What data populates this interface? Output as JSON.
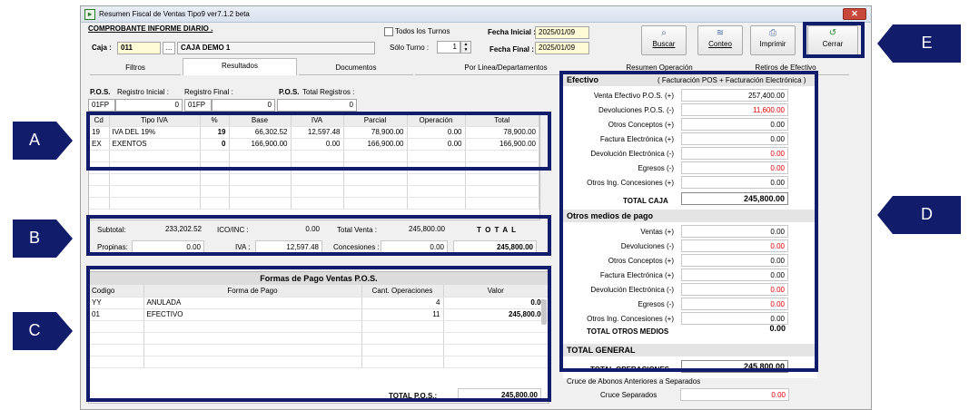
{
  "window": {
    "title": "Resumen Fiscal de Ventas Tipo9 ver7.1.2 beta",
    "close_glyph": "✕"
  },
  "header": {
    "report_title": "COMPROBANTE  INFORME DIARIO .",
    "caja_label": "Caja :",
    "caja_code": "011",
    "caja_browse": "...",
    "caja_name": "CAJA DEMO 1",
    "todos_turnos_label": "Todos los Turnos",
    "solo_turno_label": "Sólo Turno :",
    "solo_turno_value": "1",
    "fecha_inicial_label": "Fecha Inicial :",
    "fecha_inicial_value": "2025/01/09",
    "fecha_final_label": "Fecha Final :",
    "fecha_final_value": "2025/01/09"
  },
  "toolbar": {
    "buscar": "Buscar",
    "conteo": "Conteo",
    "imprimir": "Imprimir",
    "cerrar": "Cerrar"
  },
  "tabs": [
    "Filtros",
    "Resultados",
    "Documentos",
    "Por Linea/Departamentos",
    "Resumen Operación",
    "Retiros de Efectivo"
  ],
  "pos_info": {
    "pos_label": "P.O.S.",
    "registro_inicial_label": "Registro Inicial :",
    "registro_final_label": "Registro Final :",
    "pos2_label": "P.O.S.",
    "total_registros_label": "Total Registros :",
    "pos_ini": "01FP",
    "reg_ini": "0",
    "pos_fin": "01FP",
    "reg_fin": "0",
    "total_registros": "0"
  },
  "tax_table": {
    "columns": [
      "Cd",
      "Tipo IVA",
      "%",
      "Base",
      "IVA",
      "Parcial",
      "Operación",
      "Total"
    ],
    "rows": [
      [
        "19",
        "IVA DEL 19%",
        "19",
        "66,302.52",
        "12,597.48",
        "78,900.00",
        "0.00",
        "78,900.00"
      ],
      [
        "EX",
        "EXENTOS",
        "0",
        "166,900.00",
        "0.00",
        "166,900.00",
        "0.00",
        "166,900.00"
      ]
    ]
  },
  "totals": {
    "subtotal_label": "Subtotal:",
    "subtotal": "233,202.52",
    "ico_label": "ICO/INC :",
    "ico": "0.00",
    "total_venta_label": "Total Venta :",
    "total_venta": "245,800.00",
    "total_label": "T O T A L",
    "propinas_label": "Propinas:",
    "propinas": "0.00",
    "iva_label": "IVA :",
    "iva": "12,597.48",
    "concesiones_label": "Concesiones :",
    "concesiones": "0.00",
    "total": "245,800.00"
  },
  "payments": {
    "title": "Formas de Pago Ventas  P.O.S.",
    "columns": [
      "Codigo",
      "Forma de Pago",
      "Cant. Operaciones",
      "Valor"
    ],
    "rows": [
      [
        "YY",
        "ANULADA",
        "4",
        "0.00"
      ],
      [
        "01",
        "EFECTIVO",
        "11",
        "245,800.00"
      ]
    ],
    "total_label": "TOTAL  P.O.S.:",
    "total": "245,800.00"
  },
  "efectivo": {
    "title": "Efectivo",
    "subtitle": "( Facturación POS + Facturación Electrónica )",
    "rows": [
      {
        "label": "Venta Efectivo P.O.S. (+)",
        "value": "257,400.00",
        "color": "#000000"
      },
      {
        "label": "Devoluciones P.O.S.  (-)",
        "value": "11,600.00",
        "color": "#e00000"
      },
      {
        "label": "Otros Conceptos (+)",
        "value": "0.00",
        "color": "#000000"
      },
      {
        "label": "Factura Electrónica (+)",
        "value": "0.00",
        "color": "#000000"
      },
      {
        "label": "Devolución Electrónica (-)",
        "value": "0.00",
        "color": "#e00000"
      },
      {
        "label": "Egresos (-)",
        "value": "0.00",
        "color": "#e00000"
      },
      {
        "label": "Otros Ing. Concesiones (+)",
        "value": "0.00",
        "color": "#000000"
      }
    ],
    "total_label": "TOTAL CAJA",
    "total": "245,800.00"
  },
  "otros_medios": {
    "title": "Otros medios de pago",
    "rows": [
      {
        "label": "Ventas   (+)",
        "value": "0.00",
        "color": "#000000"
      },
      {
        "label": "Devoluciones   (-)",
        "value": "0.00",
        "color": "#e00000"
      },
      {
        "label": "Otros Conceptos  (+)",
        "value": "0.00",
        "color": "#000000"
      },
      {
        "label": "Factura Electrónica (+)",
        "value": "0.00",
        "color": "#000000"
      },
      {
        "label": "Devolución Electrónica (-)",
        "value": "0.00",
        "color": "#e00000"
      },
      {
        "label": "Egresos (-)",
        "value": "0.00",
        "color": "#e00000"
      },
      {
        "label": "Otros Ing. Concesiones (+)",
        "value": "0.00",
        "color": "#000000"
      }
    ],
    "total_label": "TOTAL OTROS MEDIOS",
    "total": "0.00"
  },
  "general": {
    "title": "TOTAL GENERAL",
    "total_label": "TOTAL OPERACIONES",
    "total": "245,800.00"
  },
  "cruce": {
    "title": "Cruce de Abonos Anteriores a Separados",
    "label": "Cruce Separados",
    "value": "0.00"
  },
  "callouts": {
    "a": "A",
    "b": "B",
    "c": "C",
    "d": "D",
    "e": "E"
  },
  "colors": {
    "callout": "#111c6a",
    "negative": "#e00000"
  }
}
